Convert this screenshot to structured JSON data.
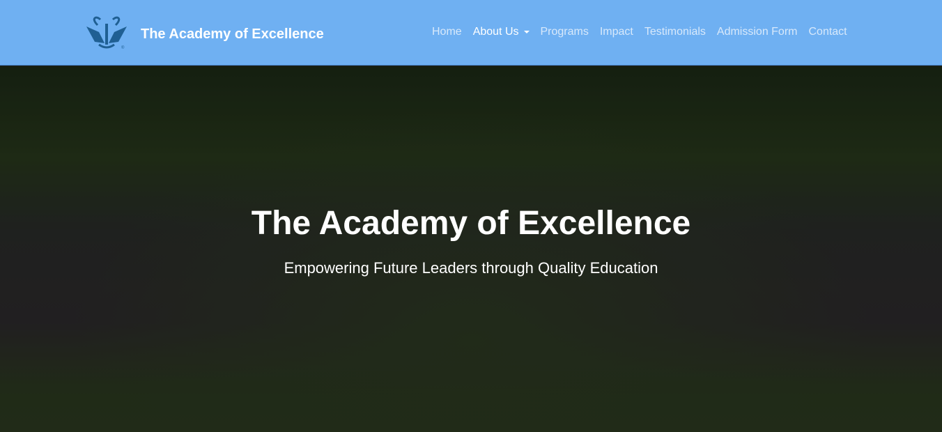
{
  "header": {
    "brand": "The Academy of Excellence",
    "logo_mark": "®",
    "menu": [
      {
        "label": "Home"
      },
      {
        "label": "About Us"
      },
      {
        "label": "Programs"
      },
      {
        "label": "Impact"
      },
      {
        "label": "Testimonials"
      },
      {
        "label": "Admission Form"
      },
      {
        "label": "Contact"
      }
    ]
  },
  "hero": {
    "title": "The Academy of Excellence",
    "subtitle": "Empowering Future Leaders through Quality Education"
  }
}
